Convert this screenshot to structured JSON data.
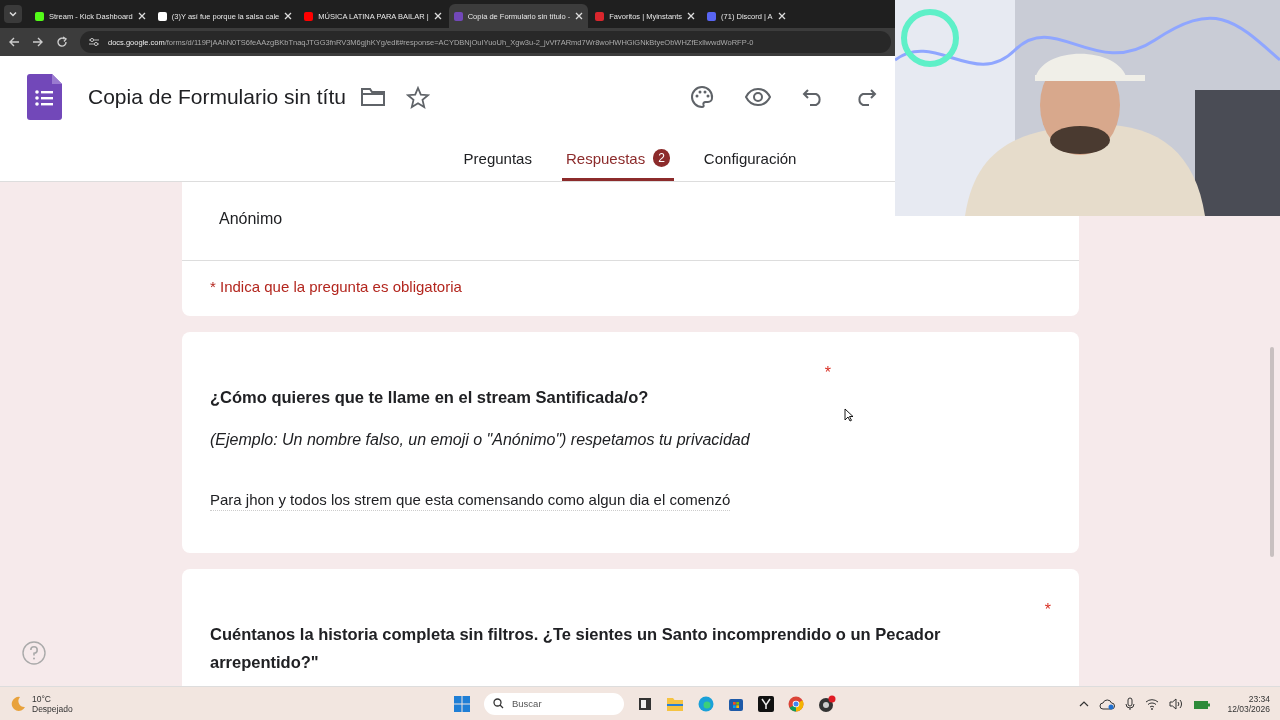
{
  "browser_tabs": [
    {
      "title": "Stream - Kick Dashboard",
      "color": "#53fc18",
      "selected": false
    },
    {
      "title": "(3)Y así fue porque la salsa cale",
      "color": "#ffffff",
      "selected": false
    },
    {
      "title": "MÚSICA LATINA PARA BAILAR |",
      "color": "#ff0000",
      "selected": false
    },
    {
      "title": "Copia de Formulario sin título -",
      "color": "#7248b9",
      "selected": true
    },
    {
      "title": "Favoritos | Myinstants",
      "color": "#d9262d",
      "selected": false
    },
    {
      "title": "(71) Discord | A",
      "color": "#5865f2",
      "selected": false
    }
  ],
  "address_bar": {
    "host": "docs.google.com",
    "path": "/forms/d/119PjAAhN0TS6feAAzgBKbTnaqJTGG3fnRV3M6gjhKYg/edit#response=ACYDBNjOuIYuoUh_Xgw3u-2_jvVf7ARmd7Wr8woHWHGiGNkBtyeObWHZfExllwwdWoRFP-0"
  },
  "form_header": {
    "title": "Copia de Formulario sin títu"
  },
  "form_tabs": [
    {
      "label": "Preguntas",
      "selected": false
    },
    {
      "label": "Respuestas",
      "selected": true,
      "badge": "2"
    },
    {
      "label": "Configuración",
      "selected": false
    }
  ],
  "cards": [
    {
      "kind": "intro",
      "respondent": "Anónimo",
      "note": "* Indica que la pregunta es obligatoria"
    },
    {
      "kind": "question",
      "required": true,
      "required_mark": "*",
      "title": "¿Cómo quieres que te llame en el stream Santificada/o?",
      "description": "(Ejemplo: Un nombre falso, un emoji o \"Anónimo\") respetamos tu privacidad",
      "answer": "Para jhon y todos los strem que esta comensando como algun dia el comenzó"
    },
    {
      "kind": "question",
      "required": true,
      "required_mark": "*",
      "title": "Cuéntanos la historia completa sin filtros. ¿Te sientes un Santo incomprendido o un Pecador arrepentido?\""
    }
  ],
  "taskbar": {
    "temperature": "10°C",
    "weather": "Despejado",
    "search_placeholder": "Buscar",
    "time": "23:34",
    "date": "12/03/2026"
  }
}
